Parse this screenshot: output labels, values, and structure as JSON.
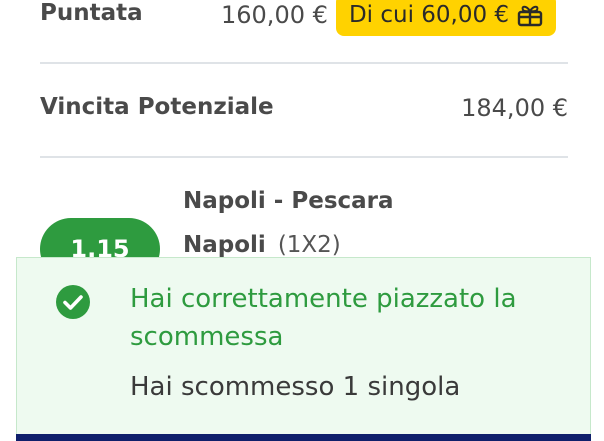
{
  "stake": {
    "label": "Puntata",
    "value": "160,00 €",
    "bonus_label": "Di cui 60,00 €",
    "bonus_icon": "gift-icon"
  },
  "potential_win": {
    "label": "Vincita Potenziale",
    "value": "184,00 €"
  },
  "selection": {
    "odds": "1.15",
    "event": "Napoli - Pescara",
    "pick": "Napoli",
    "market": "(1X2)"
  },
  "toast": {
    "icon": "check-circle-icon",
    "title": "Hai correttamente piazzato la scommessa",
    "message": "Hai scommesso 1 singola"
  },
  "colors": {
    "success_green": "#2e9b3f",
    "bonus_yellow": "#ffd200",
    "toast_background": "#eefaf0",
    "bottom_bar": "#0f1f6b"
  }
}
